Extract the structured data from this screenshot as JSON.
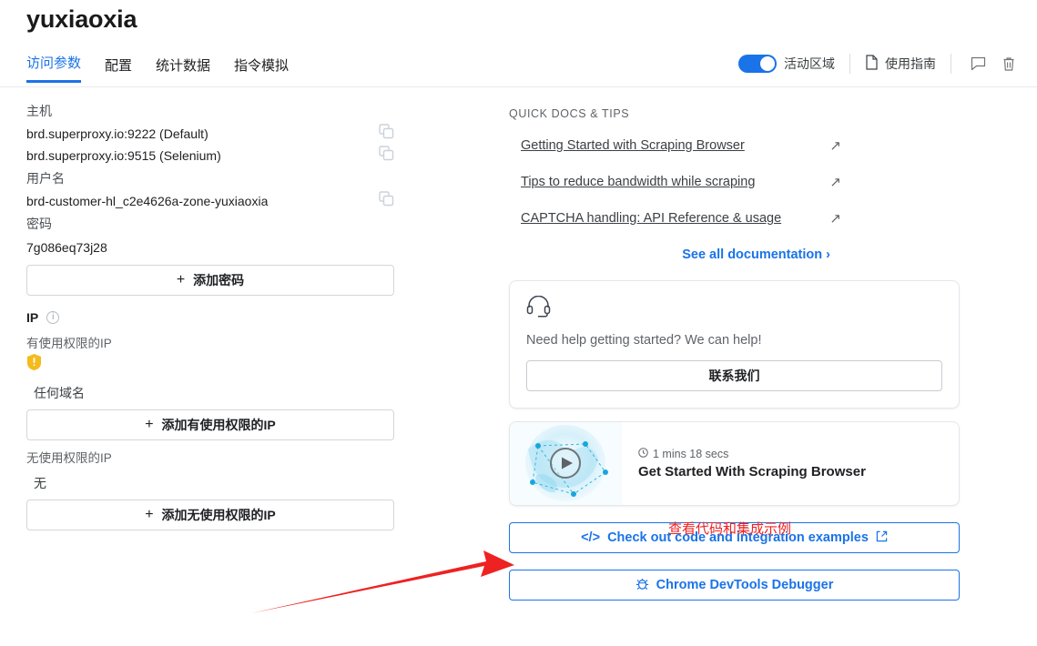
{
  "header": {
    "title": "yuxiaoxia",
    "tabs": [
      {
        "label": "访问参数",
        "active": true
      },
      {
        "label": "配置",
        "active": false
      },
      {
        "label": "统计数据",
        "active": false
      },
      {
        "label": "指令模拟",
        "active": false
      }
    ],
    "toggle_label": "活动区域",
    "toggle_on": true,
    "guide_label": "使用指南",
    "icons": [
      "file-icon",
      "comment-icon",
      "trash-icon"
    ]
  },
  "left": {
    "host_label": "主机",
    "hosts": [
      "brd.superproxy.io:9222 (Default)",
      "brd.superproxy.io:9515 (Selenium)"
    ],
    "username_label": "用户名",
    "username": "brd-customer-hl_c2e4626a-zone-yuxiaoxia",
    "password_label": "密码",
    "password": "7g086eq73j28",
    "add_password_btn": "添加密码",
    "ip_label": "IP",
    "allowed_ip_label": "有使用权限的IP",
    "any_domain": "任何域名",
    "add_allowed_ip_btn": "添加有使用权限的IP",
    "denied_ip_label": "无使用权限的IP",
    "denied_ip_value": "无",
    "add_denied_ip_btn": "添加无使用权限的IP"
  },
  "right": {
    "kicker": "QUICK DOCS & TIPS",
    "docs": [
      "Getting Started with Scraping Browser",
      "Tips to reduce bandwidth while scraping",
      "CAPTCHA handling: API Reference & usage"
    ],
    "see_all": "See all documentation",
    "help": {
      "text": "Need help getting started? We can help!",
      "button": "联系我们"
    },
    "video": {
      "duration": "1 mins 18 secs",
      "title": "Get Started With Scraping Browser"
    },
    "code_btn": "Check out code and integration examples",
    "devtools_btn": "Chrome DevTools Debugger"
  },
  "annotations": {
    "note": "查看代码和集成示例",
    "color": "#ee2222"
  },
  "colors": {
    "accent_blue": "#1a73e8",
    "warning_yellow": "#f5bb1d",
    "annotation_red": "#ee2222"
  }
}
